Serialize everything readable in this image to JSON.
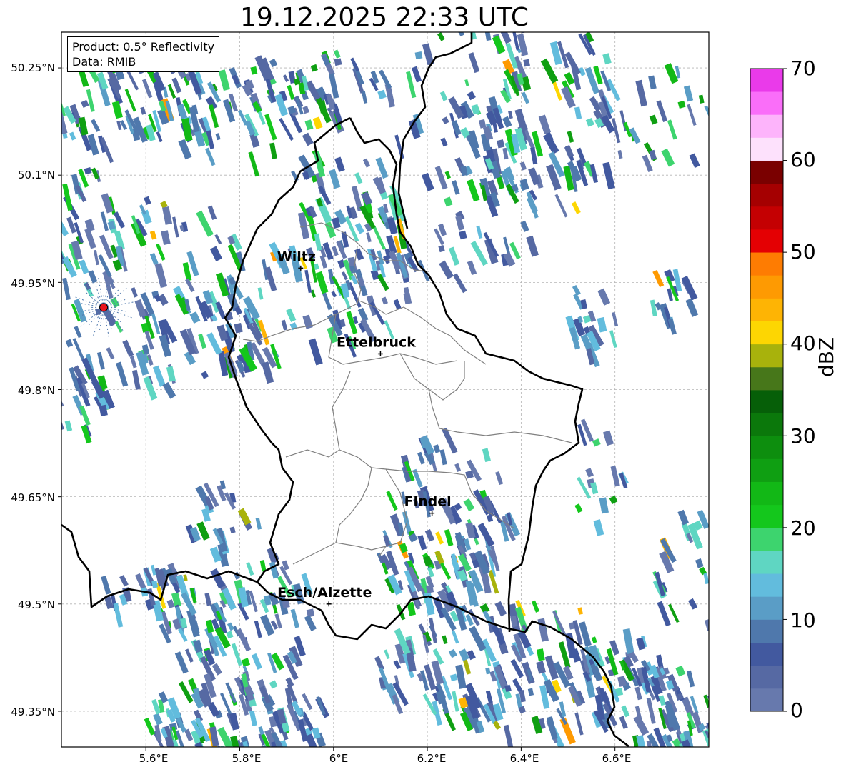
{
  "title": "19.12.2025 22:33 UTC",
  "info": {
    "product": "Product: 0.5° Reflectivity",
    "source": "Data: RMIB"
  },
  "map": {
    "lon_range": [
      5.42,
      6.8
    ],
    "lat_range": [
      49.3,
      50.3
    ],
    "x_ticks": [
      "5.6°E",
      "5.8°E",
      "6°E",
      "6.2°E",
      "6.4°E",
      "6.6°E"
    ],
    "y_ticks": [
      "50.25°N",
      "50.1°N",
      "49.95°N",
      "49.8°N",
      "49.65°N",
      "49.5°N",
      "49.35°N"
    ],
    "grid": true,
    "radar_site": {
      "lon": 5.51,
      "lat": 49.915,
      "color": "#e8141e"
    },
    "cities": [
      {
        "name": "Wiltz",
        "lon": 5.93,
        "lat": 49.97
      },
      {
        "name": "Ettelbruck",
        "lon": 6.1,
        "lat": 49.85
      },
      {
        "name": "Findel",
        "lon": 6.21,
        "lat": 49.627
      },
      {
        "name": "Esch/Alzette",
        "lon": 5.99,
        "lat": 49.5
      }
    ]
  },
  "colorbar": {
    "label": "dBZ",
    "ticks": [
      "0",
      "10",
      "20",
      "30",
      "40",
      "50",
      "60",
      "70"
    ],
    "min": 0,
    "max": 70,
    "step": 2.5,
    "colors": [
      "#6779ad",
      "#5669a3",
      "#42599f",
      "#4f78ac",
      "#5a9dc6",
      "#62bcdd",
      "#5fd6c2",
      "#3dd46e",
      "#14c71c",
      "#12b816",
      "#0f9f12",
      "#0d8e0e",
      "#0b780b",
      "#065f08",
      "#47771a",
      "#a8b20c",
      "#fdd602",
      "#feb404",
      "#fe9a02",
      "#fe7c02",
      "#e40003",
      "#c40002",
      "#a50001",
      "#7a0000",
      "#fde1fc",
      "#fdb4fb",
      "#fa6ef9",
      "#ea3aea"
    ]
  }
}
